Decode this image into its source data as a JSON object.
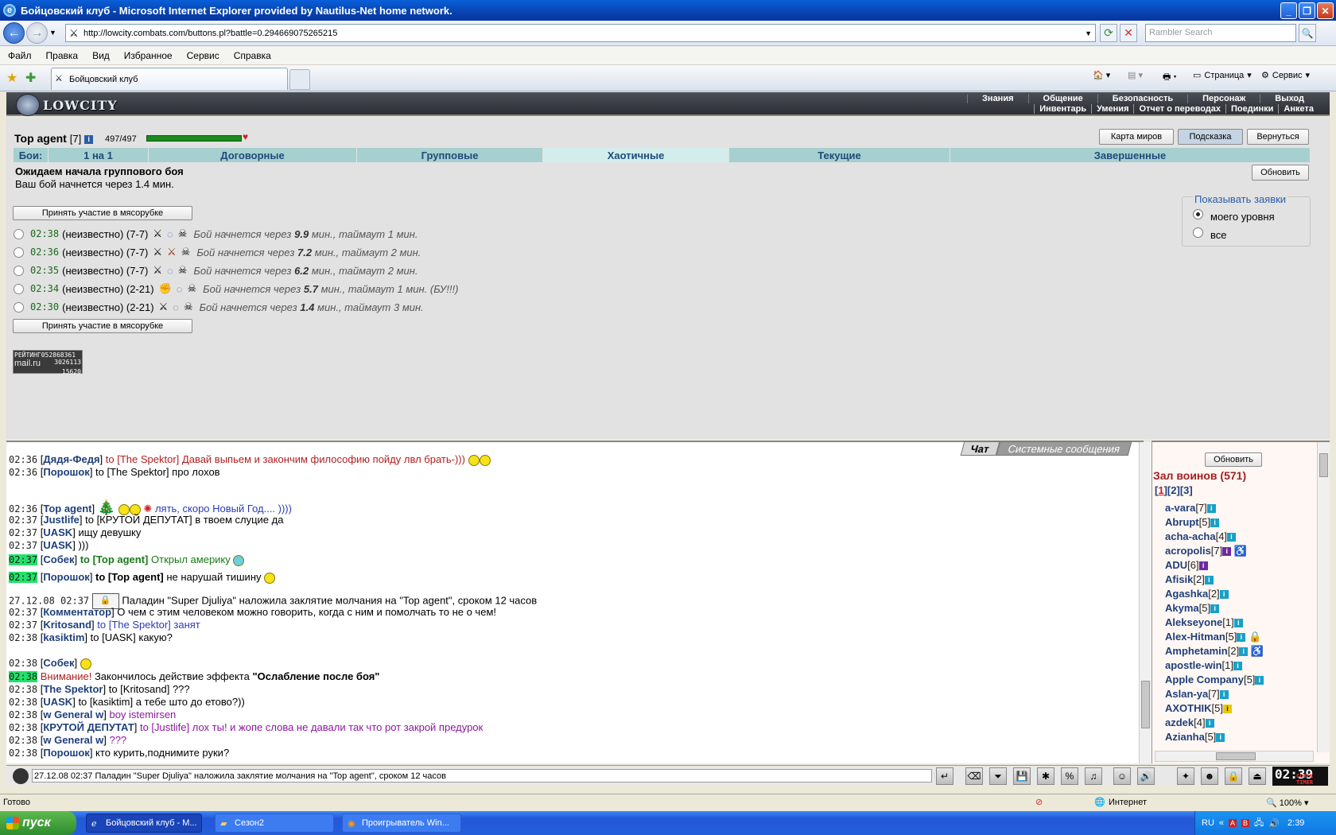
{
  "window": {
    "title": "Бойцовский клуб - Microsoft Internet Explorer provided by Nautilus-Net home network."
  },
  "address": {
    "url": "http://lowcity.combats.com/buttons.pl?battle=0.294669075265215",
    "search_placeholder": "Rambler Search"
  },
  "menu": [
    "Файл",
    "Правка",
    "Вид",
    "Избранное",
    "Сервис",
    "Справка"
  ],
  "tabs": {
    "active": "Бойцовский клуб",
    "toolbar_page": "Страница",
    "toolbar_service": "Сервис"
  },
  "game": {
    "logo": "LOWCITY",
    "nav_top": [
      "Знания",
      "Общение",
      "Безопасность",
      "Персонаж",
      "Выход"
    ],
    "nav_bottom": [
      "Инвентарь",
      "Умения",
      "Отчет о переводах",
      "Поединки",
      "Анкета"
    ],
    "character": {
      "name": "Top agent",
      "level": "[7]",
      "hp": "497/497",
      "hp_fraction": 1.0
    },
    "buttons": {
      "map": "Карта миров",
      "hint": "Подсказка",
      "back": "Вернуться",
      "refresh": "Обновить",
      "join": "Принять участие в мясорубке"
    },
    "battle_tabs": [
      "Бои:",
      "1 на 1",
      "Договорные",
      "Групповые",
      "Хаотичные",
      "Текущие",
      "Завершенные"
    ],
    "status_title": "Ожидаем начала группового боя",
    "status_text": "Ваш бой начнется через 1.4 мин.",
    "show": {
      "title": "Показывать заявки",
      "mine": "моего уровня",
      "all": "все"
    },
    "battles": [
      {
        "time": "02:38",
        "who": "(неизвестно)",
        "range": "(7-7)",
        "prefix": "Бой начнется через",
        "mins": "9.9",
        "suffix": "мин., таймаут 1 мин."
      },
      {
        "time": "02:36",
        "who": "(неизвестно)",
        "range": "(7-7)",
        "prefix": "Бой начнется через",
        "mins": "7.2",
        "suffix": "мин., таймаут 2 мин."
      },
      {
        "time": "02:35",
        "who": "(неизвестно)",
        "range": "(7-7)",
        "prefix": "Бой начнется через",
        "mins": "6.2",
        "suffix": "мин., таймаут 2 мин."
      },
      {
        "time": "02:34",
        "who": "(неизвестно)",
        "range": "(2-21)",
        "prefix": "Бой начнется через",
        "mins": "5.7",
        "suffix": "мин., таймаут 1 мин. (БУ!!!)"
      },
      {
        "time": "02:30",
        "who": "(неизвестно)",
        "range": "(2-21)",
        "prefix": "Бой начнется через",
        "mins": "1.4",
        "suffix": "мин., таймаут 3 мин."
      }
    ],
    "rating": {
      "label": "РЕЙТИНГ",
      "num1": "052868361",
      "brand": "mail.ru",
      "num2": "3026113",
      "num3": "15620"
    }
  },
  "chat": {
    "tab_chat": "Чат",
    "tab_system": "Системные сообщения",
    "lines": [
      {
        "time": "02:36",
        "name": "Дядя-Федя",
        "to": "to [The Spektor]",
        "text": "Давай выпьем и закончим философию пойду лвл брать-)))"
      },
      {
        "time": "02:36",
        "name": "Порошок",
        "to": "to [The Spektor]",
        "text": "про лохов"
      },
      {
        "time": "02:36",
        "name": "Top agent",
        "text": "лять, скоро Новый Год.... ))))"
      },
      {
        "time": "02:37",
        "name": "Justlife",
        "to": "to [КРУТОЙ ДЕПУТАТ]",
        "text": "в твоем слуцие да"
      },
      {
        "time": "02:37",
        "name": "UASK",
        "text": "ищу девушку"
      },
      {
        "time": "02:37",
        "name": "UASK",
        "text": ")))"
      },
      {
        "time": "02:37",
        "name": "Собек",
        "to": "to [Top agent]",
        "text": "Открыл америку"
      },
      {
        "time": "02:37",
        "name": "Порошок",
        "to": "to [Top agent]",
        "text": "не нарушай тишину"
      },
      {
        "time": "27.12.08 02:37",
        "text": "Паладин \"Super Djuliya\" наложила заклятие молчания на \"Top agent\", сроком 12 часов"
      },
      {
        "time": "02:37",
        "name": "Комментатор",
        "text": "О чем с этим человеком можно говорить, когда с ним и помолчать то не о чем!"
      },
      {
        "time": "02:37",
        "name": "Kritosand",
        "to": "to [The Spektor]",
        "text": "занят"
      },
      {
        "time": "02:38",
        "name": "kasiktim",
        "to": "to [UASK]",
        "text": "какую?"
      },
      {
        "time": "02:38",
        "name": "Собек"
      },
      {
        "time": "02:38",
        "label": "Внимание!",
        "text": "Закончилось действие эффекта",
        "bold": "\"Ослабление после боя\""
      },
      {
        "time": "02:38",
        "name": "The Spektor",
        "to": "to [Kritosand]",
        "text": "???"
      },
      {
        "time": "02:38",
        "name": "UASK",
        "to": "to [kasiktim]",
        "text": "а тебе што до етово?))"
      },
      {
        "time": "02:38",
        "name": "w General w",
        "text": "boy istemirsen"
      },
      {
        "time": "02:38",
        "name": "КРУТОЙ ДЕПУТАТ",
        "to": "to [Justlife]",
        "text": "лох ты! и жопе слова не давали так что рот закрой предурок"
      },
      {
        "time": "02:38",
        "name": "w General w",
        "text": "???"
      },
      {
        "time": "02:38",
        "name": "Порошок",
        "text": "кто курить,поднимите руки?"
      }
    ],
    "input_value": "27.12.08 02:37  Паладин \"Super Djuliya\" наложила заклятие молчания на \"Top agent\", сроком 12 часов"
  },
  "online": {
    "refresh": "Обновить",
    "title": "Зал воинов (571)",
    "pages": [
      "1",
      "2",
      "3"
    ],
    "users": [
      {
        "name": "a-vara",
        "lvl": "[7]"
      },
      {
        "name": "Abrupt",
        "lvl": "[5]"
      },
      {
        "name": "acha-acha",
        "lvl": "[4]"
      },
      {
        "name": "acropolis",
        "lvl": "[7]"
      },
      {
        "name": "ADU",
        "lvl": "[6]"
      },
      {
        "name": "Afisik",
        "lvl": "[2]"
      },
      {
        "name": "Agashka",
        "lvl": "[2]"
      },
      {
        "name": "Akyma",
        "lvl": "[5]"
      },
      {
        "name": "Alekseyone",
        "lvl": "[1]"
      },
      {
        "name": "Alex-Hitman",
        "lvl": "[5]"
      },
      {
        "name": "Amphetamin",
        "lvl": "[2]"
      },
      {
        "name": "apostle-win",
        "lvl": "[1]"
      },
      {
        "name": "Apple Company",
        "lvl": "[5]"
      },
      {
        "name": "Aslan-ya",
        "lvl": "[7]"
      },
      {
        "name": "AXOTHIK",
        "lvl": "[5]"
      },
      {
        "name": "azdek",
        "lvl": "[4]"
      },
      {
        "name": "Azianha",
        "lvl": "[5]"
      }
    ]
  },
  "clock": {
    "time": "02:39",
    "label": "CLOCK TIMER"
  },
  "statusbar": {
    "left": "Готово",
    "zone": "Интернет",
    "zoom": "100%"
  },
  "taskbar": {
    "start": "пуск",
    "tasks": [
      "Бойцовский клуб - М...",
      "Сезон2",
      "Проигрыватель Win..."
    ],
    "lang": "RU",
    "time": "2:39"
  }
}
